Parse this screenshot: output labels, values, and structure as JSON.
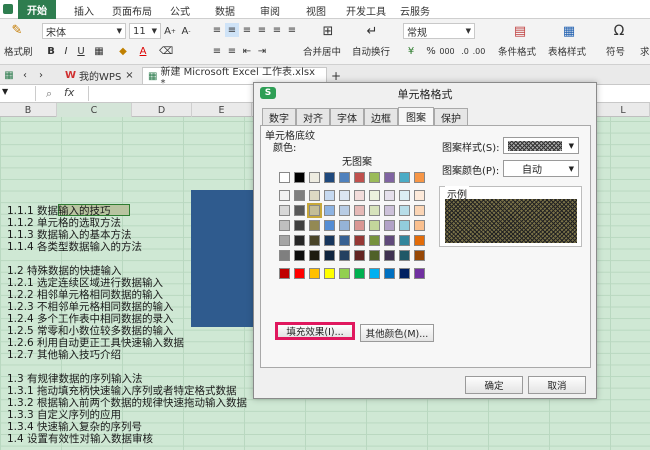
{
  "menubar": {
    "items": [
      "开始",
      "插入",
      "页面布局",
      "公式",
      "数据",
      "审阅",
      "视图",
      "开发工具",
      "云服务"
    ]
  },
  "ribbon": {
    "format_painter": "格式刷",
    "font_name": "宋体",
    "font_size": "11",
    "merge_center": "合并居中",
    "auto_wrap": "自动换行",
    "number_format": "常规",
    "cond_format": "条件格式",
    "table_style": "表格样式",
    "symbol": "符号",
    "more": "求"
  },
  "doctabs": {
    "wps": "我的WPS",
    "file": "新建 Microsoft Excel 工作表.xlsx *",
    "add": "+"
  },
  "formula_bar": {
    "fx": "fx",
    "name_box": ""
  },
  "columns": [
    "B",
    "C",
    "D",
    "E",
    "L"
  ],
  "sheet_lines": [
    "1.1.1 数据输入的技巧",
    "1.1.2 单元格的选取方法",
    "1.1.3 数据输入的基本方法",
    "1.1.4 各类型数据输入的方法",
    "",
    "1.2 特殊数据的快捷输入",
    "1.2.1 选定连续区域进行数据输入",
    "1.2.2 相邻单元格相同数据的输入",
    "1.2.3 不相邻单元格相同数据的输入",
    "1.2.4 多个工作表中相同数据的录入",
    "1.2.5 常零和小数位较多数据的输入",
    "1.2.6 利用自动更正工具快速输入数据",
    "1.2.7 其他输入技巧介绍",
    "",
    "1.3 有规律数据的序列输入法",
    "1.3.1 拖动填充柄快速输入序列或者特定格式数据",
    "1.3.2 根据输入前两个数据的规律快速拖动输入数据",
    "1.3.3 自定义序列的应用",
    "1.3.4 快速输入复杂的序列号",
    "1.4 设置有效性对输入数据审核"
  ],
  "dialog": {
    "title": "单元格格式",
    "tabs": [
      "数字",
      "对齐",
      "字体",
      "边框",
      "图案",
      "保护"
    ],
    "active_tab": "图案",
    "section": "单元格底纹",
    "color_label": "颜色:",
    "no_color": "无图案",
    "fill_effect": "填充效果(I)...",
    "more_colors": "其他颜色(M)...",
    "pattern_style_label": "图案样式(S):",
    "pattern_color_label": "图案颜色(P):",
    "pattern_color_value": "自动",
    "sample_label": "示例",
    "ok": "确定",
    "cancel": "取消",
    "colors": {
      "row1": [
        "#ffffff",
        "#000000",
        "#eeece1",
        "#1f497d",
        "#4f81bd",
        "#c0504d",
        "#9bbb59",
        "#8064a2",
        "#4bacc6",
        "#f79646"
      ],
      "row2": [
        "#f2f2f2",
        "#7f7f7f",
        "#ddd9c3",
        "#c6d9f0",
        "#dbe5f1",
        "#f2dcdb",
        "#ebf1dd",
        "#e5e0ec",
        "#dbeef3",
        "#fdeada"
      ],
      "row3": [
        "#d8d8d8",
        "#595959",
        "#c4bd97",
        "#8db3e2",
        "#b8cce4",
        "#e5b9b7",
        "#d7e3bc",
        "#ccc1d9",
        "#b7dde8",
        "#fbd5b5"
      ],
      "row4": [
        "#bfbfbf",
        "#3f3f3f",
        "#938953",
        "#548dd4",
        "#95b3d7",
        "#d99694",
        "#c3d69b",
        "#b2a2c7",
        "#92cddc",
        "#fac08f"
      ],
      "row5": [
        "#a5a5a5",
        "#262626",
        "#494429",
        "#17365d",
        "#366092",
        "#953734",
        "#76923c",
        "#5f497a",
        "#31859b",
        "#e36c09"
      ],
      "row6": [
        "#7f7f7f",
        "#0c0c0c",
        "#1d1b10",
        "#0f243e",
        "#244061",
        "#632423",
        "#4f6128",
        "#3f3151",
        "#205867",
        "#974806"
      ],
      "row7": [
        "#c00000",
        "#ff0000",
        "#ffc000",
        "#ffff00",
        "#92d050",
        "#00b050",
        "#00b0f0",
        "#0070c0",
        "#002060",
        "#7030a0"
      ]
    }
  }
}
